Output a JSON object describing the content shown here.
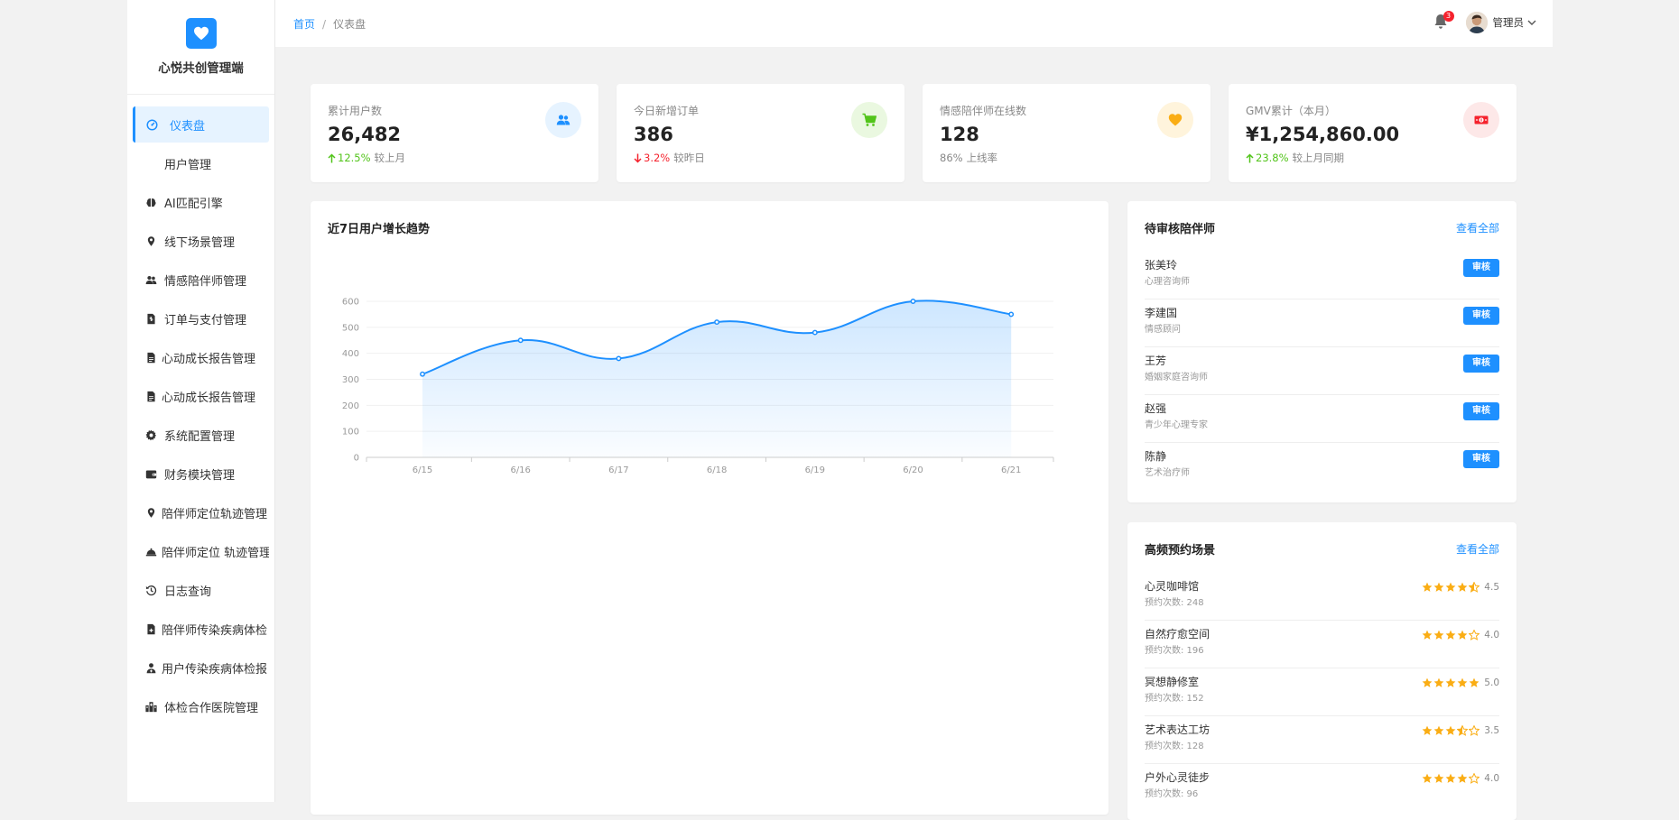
{
  "brand": {
    "name": "心悦共创管理端",
    "logo_icon": "heart-icon",
    "color": "#1e90ff"
  },
  "sidebar": {
    "items": [
      {
        "label": "仪表盘",
        "icon": "dashboard-icon",
        "active": true
      },
      {
        "label": "用户管理",
        "icon": ""
      },
      {
        "label": "AI匹配引擎",
        "icon": "brain-icon"
      },
      {
        "label": "线下场景管理",
        "icon": "location-icon"
      },
      {
        "label": "情感陪伴师管理",
        "icon": "users-icon"
      },
      {
        "label": "订单与支付管理",
        "icon": "invoice-icon"
      },
      {
        "label": "心动成长报告管理",
        "icon": "file-icon"
      },
      {
        "label": "心动成长报告管理",
        "icon": "file-icon"
      },
      {
        "label": "系统配置管理",
        "icon": "gear-icon"
      },
      {
        "label": "财务模块管理",
        "icon": "wallet-icon"
      },
      {
        "label": "陪伴师定位轨迹管理",
        "icon": "location-icon"
      },
      {
        "label": "陪伴师定位 轨迹管理",
        "icon": "bell-service-icon"
      },
      {
        "label": "日志查询",
        "icon": "history-icon"
      },
      {
        "label": "陪伴师传染疾病体检",
        "icon": "medical-file-icon"
      },
      {
        "label": "用户传染疾病体检报",
        "icon": "user-doctor-icon"
      },
      {
        "label": "体检合作医院管理",
        "icon": "hospital-icon"
      }
    ]
  },
  "header": {
    "breadcrumb": {
      "home": "首页",
      "separator": "/",
      "current": "仪表盘"
    },
    "notifications": "3",
    "user": "管理员"
  },
  "stats": [
    {
      "label": "累计用户数",
      "value": "26,482",
      "trend": "up",
      "delta": "12.5%",
      "note": "较上月",
      "icon": "users-icon",
      "color": "#1e90ff",
      "bg": "#e6f3ff"
    },
    {
      "label": "今日新增订单",
      "value": "386",
      "trend": "down",
      "delta": "3.2%",
      "note": "较昨日",
      "icon": "cart-icon",
      "color": "#52c41a",
      "bg": "#eaf8e0"
    },
    {
      "label": "情感陪伴师在线数",
      "value": "128",
      "trend": "none",
      "delta": "86%",
      "note": "上线率",
      "icon": "heart-icon",
      "color": "#faad14",
      "bg": "#fff4dc"
    },
    {
      "label": "GMV累计（本月）",
      "value": "¥1,254,860.00",
      "trend": "up",
      "delta": "23.8%",
      "note": "较上月同期",
      "icon": "money-icon",
      "color": "#f5222d",
      "bg": "#fde8e8"
    }
  ],
  "chart_panel": {
    "title": "近7日用户增长趋势"
  },
  "chart_data": {
    "type": "area",
    "x": [
      "6/15",
      "6/16",
      "6/17",
      "6/18",
      "6/19",
      "6/20",
      "6/21"
    ],
    "series": [
      {
        "values": [
          320,
          450,
          380,
          520,
          480,
          600,
          550
        ]
      }
    ],
    "ylim": [
      0,
      600
    ],
    "yticks": [
      0,
      100,
      200,
      300,
      400,
      500,
      600
    ],
    "grid": true,
    "smooth": true,
    "color": "#1e90ff"
  },
  "pending": {
    "title": "待审核陪伴师",
    "link": "查看全部",
    "button_label": "审核",
    "items": [
      {
        "name": "张美玲",
        "role": "心理咨询师"
      },
      {
        "name": "李建国",
        "role": "情感顾问"
      },
      {
        "name": "王芳",
        "role": "婚姻家庭咨询师"
      },
      {
        "name": "赵强",
        "role": "青少年心理专家"
      },
      {
        "name": "陈静",
        "role": "艺术治疗师"
      }
    ]
  },
  "scenes": {
    "title": "高频预约场景",
    "link": "查看全部",
    "items": [
      {
        "name": "心灵咖啡馆",
        "count": "预约次数: 248",
        "rating": 4.5,
        "score": "4.5"
      },
      {
        "name": "自然疗愈空间",
        "count": "预约次数: 196",
        "rating": 4.0,
        "score": "4.0"
      },
      {
        "name": "冥想静修室",
        "count": "预约次数: 152",
        "rating": 5.0,
        "score": "5.0"
      },
      {
        "name": "艺术表达工坊",
        "count": "预约次数: 128",
        "rating": 3.5,
        "score": "3.5"
      },
      {
        "name": "户外心灵徒步",
        "count": "预约次数: 96",
        "rating": 4.0,
        "score": "4.0"
      }
    ]
  }
}
